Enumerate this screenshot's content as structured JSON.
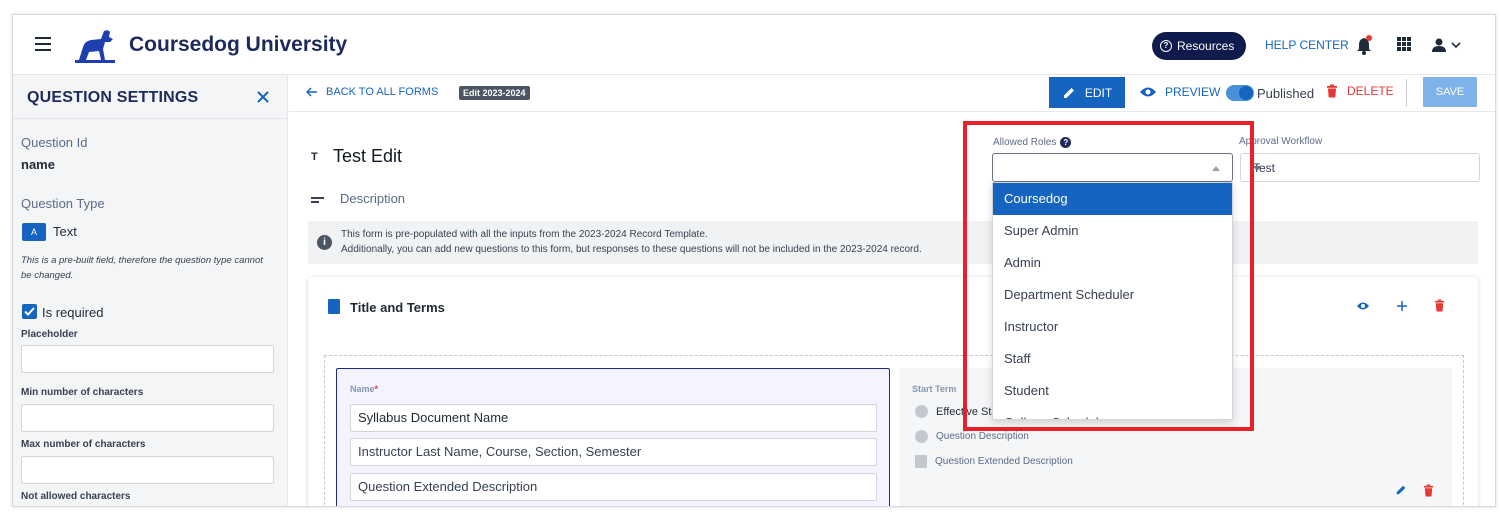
{
  "header": {
    "app_title": "Coursedog University",
    "resources_label": "Resources",
    "help_center_label": "HELP CENTER"
  },
  "sidebar": {
    "title": "QUESTION SETTINGS",
    "question_id_label": "Question Id",
    "question_id_value": "name",
    "question_type_label": "Question Type",
    "question_type_value": "Text",
    "prebuilt_note": "This is a pre-built field, therefore the question type cannot be changed.",
    "is_required_label": "Is required",
    "placeholder_label": "Placeholder",
    "min_chars_label": "Min number of characters",
    "max_chars_label": "Max number of characters",
    "not_allowed_label": "Not allowed characters"
  },
  "toolbar": {
    "back_label": "BACK TO ALL FORMS",
    "edit_tag": "Edit 2023-2024",
    "edit_label": "EDIT",
    "preview_label": "PREVIEW",
    "published_label": "Published",
    "delete_label": "DELETE",
    "save_label": "SAVE"
  },
  "form": {
    "title": "Test Edit",
    "description": "Description",
    "allowed_roles_label": "Allowed Roles",
    "approval_workflow_label": "Approval Workflow",
    "approval_workflow_value": "Test",
    "roles_options": [
      "Coursedog",
      "Super Admin",
      "Admin",
      "Department Scheduler",
      "Instructor",
      "Staff",
      "Student",
      "College Scheduler"
    ],
    "info_line_1": "This form is pre-populated with all the inputs from the 2023-2024 Record Template.",
    "info_line_2": "Additionally, you can add new questions to this form, but responses to these questions will not be included in the 2023-2024 record."
  },
  "section": {
    "title": "Title and Terms",
    "name_label": "Name",
    "name_inputs": [
      "Syllabus Document Name",
      "Instructor Last Name, Course, Section, Semester",
      "Question Extended Description"
    ],
    "term_label": "Start Term",
    "term_rows": [
      "Effective Start",
      "Question Description",
      "Question Extended Description"
    ]
  },
  "colors": {
    "primary": "#1565c0",
    "danger": "#e53935",
    "highlight": "#e8202a",
    "navy": "#0f1b4d"
  }
}
